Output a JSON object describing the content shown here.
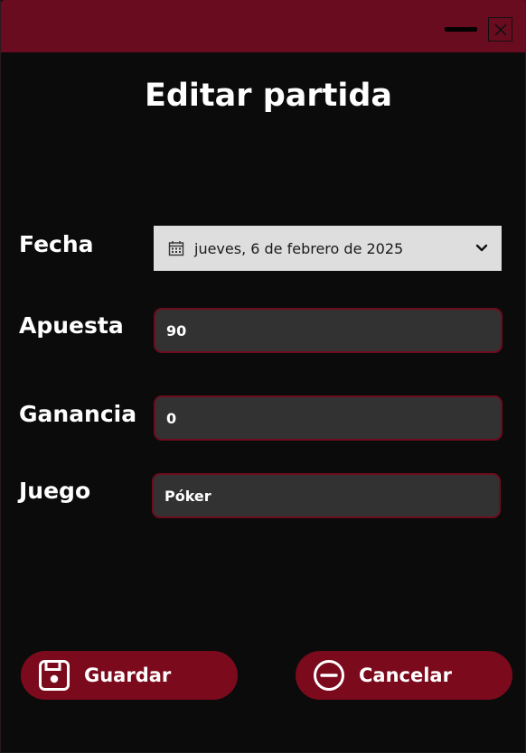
{
  "window": {
    "title_bar_color": "#6a0c20",
    "background_color": "#0b0b0c"
  },
  "title": "Editar partida",
  "form": {
    "fecha": {
      "label": "Fecha",
      "value": "jueves, 6 de febrero de 2025",
      "icon": "calendar-icon"
    },
    "apuesta": {
      "label": "Apuesta",
      "value": "90"
    },
    "ganancia": {
      "label": "Ganancia",
      "value": "0"
    },
    "juego": {
      "label": "Juego",
      "value": "Póker"
    }
  },
  "buttons": {
    "save": {
      "label": "Guardar",
      "icon": "floppy-disk-icon"
    },
    "cancel": {
      "label": "Cancelar",
      "icon": "minus-circle-icon"
    }
  },
  "colors": {
    "accent": "#7b0a1c",
    "field_border": "#6e0c1f",
    "field_bg": "#323232",
    "datepicker_bg": "#dedede"
  }
}
